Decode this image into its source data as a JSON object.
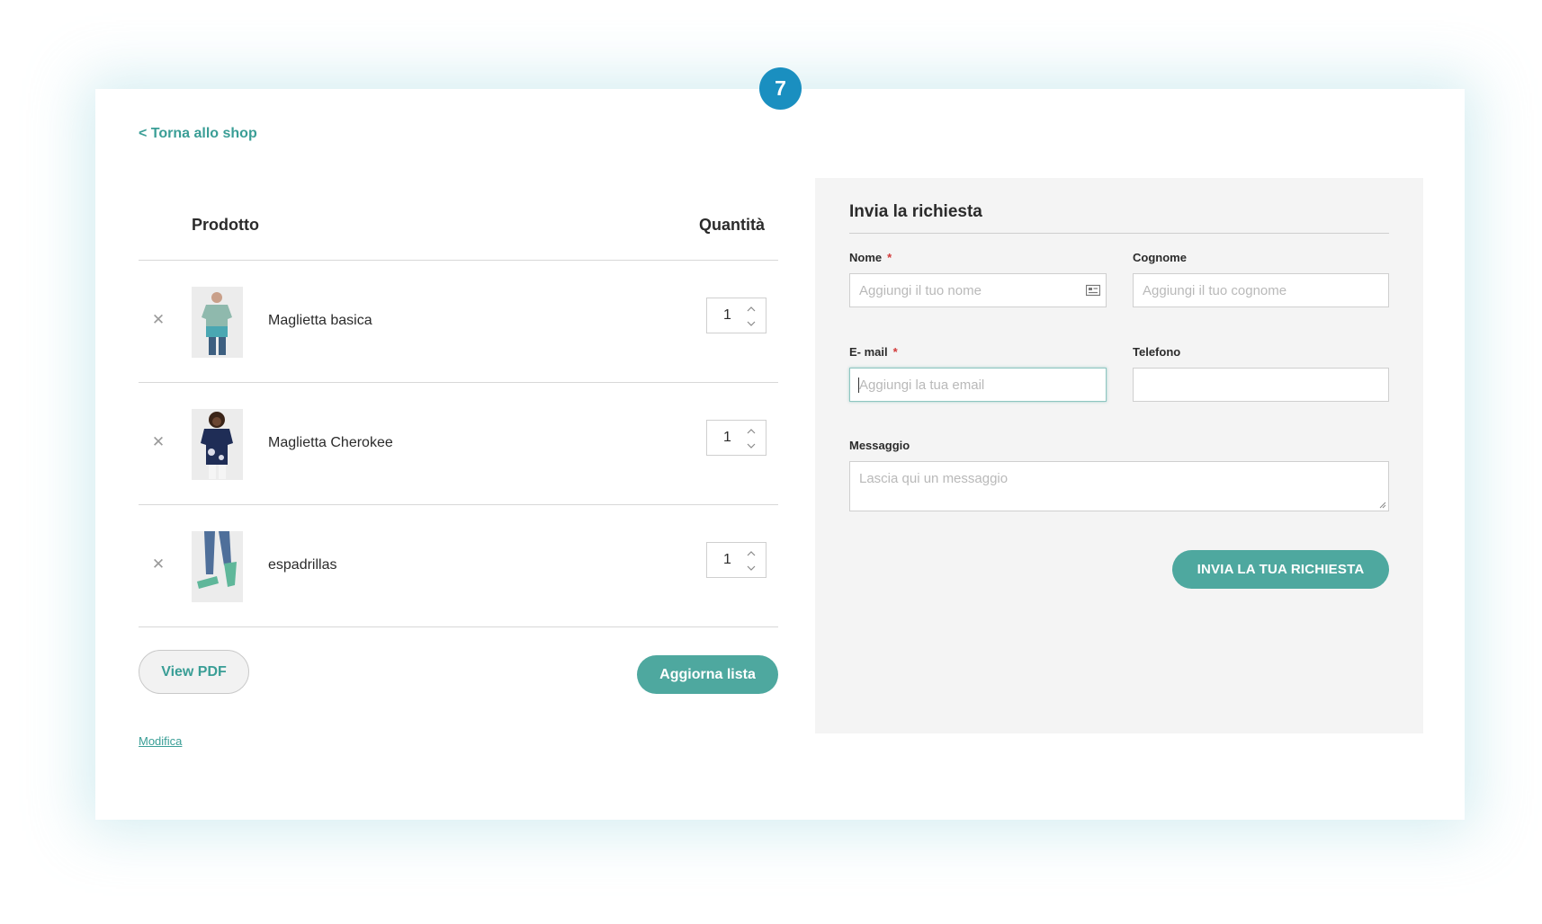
{
  "step_badge": "7",
  "back_link": "< Torna allo shop",
  "table": {
    "product_header": "Prodotto",
    "quantity_header": "Quantità",
    "rows": [
      {
        "name": "Maglietta basica",
        "qty": "1"
      },
      {
        "name": "Maglietta Cherokee",
        "qty": "1"
      },
      {
        "name": "espadrillas",
        "qty": "1"
      }
    ]
  },
  "buttons": {
    "view_pdf": "View PDF",
    "update_list": "Aggiorna lista",
    "edit": "Modifica",
    "submit": "INVIA LA TUA RICHIESTA"
  },
  "form": {
    "title": "Invia la richiesta",
    "required_mark": "*",
    "first_name": {
      "label": "Nome",
      "placeholder": "Aggiungi il tuo nome"
    },
    "last_name": {
      "label": "Cognome",
      "placeholder": "Aggiungi il tuo cognome"
    },
    "email": {
      "label": "E- mail",
      "placeholder": "Aggiungi la tua email"
    },
    "phone": {
      "label": "Telefono",
      "placeholder": ""
    },
    "message": {
      "label": "Messaggio",
      "placeholder": "Lascia qui un messaggio"
    }
  },
  "colors": {
    "accent": "#4ea89f",
    "link": "#3a9e96",
    "badge": "#1a8fc0",
    "required": "#d23a3a",
    "panel_bg": "#f4f4f4"
  },
  "icons": [
    "close-icon",
    "chevron-up-icon",
    "chevron-down-icon",
    "contact-card-icon",
    "resize-handle-icon"
  ]
}
